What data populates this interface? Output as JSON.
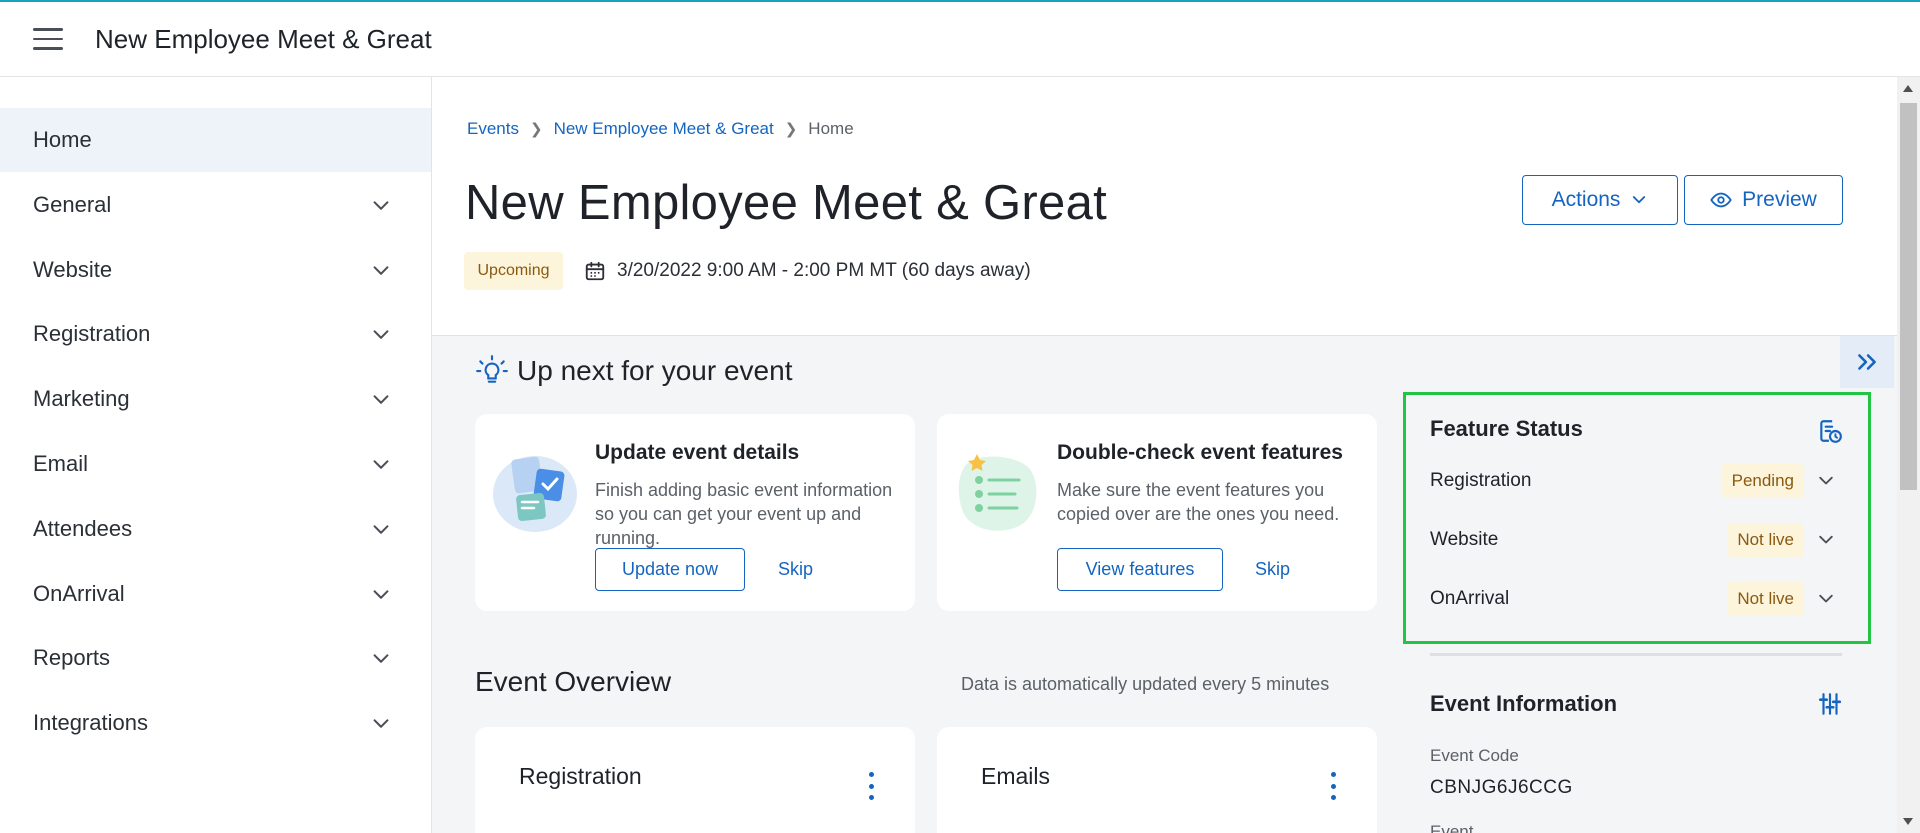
{
  "app": {
    "title": "New Employee Meet & Great"
  },
  "sidebar": {
    "items": [
      {
        "label": "Home",
        "active": true
      },
      {
        "label": "General"
      },
      {
        "label": "Website"
      },
      {
        "label": "Registration"
      },
      {
        "label": "Marketing"
      },
      {
        "label": "Email"
      },
      {
        "label": "Attendees"
      },
      {
        "label": "OnArrival"
      },
      {
        "label": "Reports"
      },
      {
        "label": "Integrations"
      }
    ]
  },
  "breadcrumb": {
    "items": [
      "Events",
      "New Employee Meet & Great"
    ],
    "current": "Home"
  },
  "header": {
    "title": "New Employee Meet & Great",
    "status": "Upcoming",
    "date_range": "3/20/2022 9:00 AM - 2:00 PM MT (60 days away)",
    "actions_label": "Actions",
    "preview_label": "Preview"
  },
  "up_next": {
    "title": "Up next for your event",
    "cards": [
      {
        "title": "Update event details",
        "description": "Finish adding basic event information so you can get your event up and running.",
        "primary_label": "Update now",
        "skip_label": "Skip"
      },
      {
        "title": "Double-check event features",
        "description": "Make sure the event features you copied over are the ones you need.",
        "primary_label": "View features",
        "skip_label": "Skip"
      }
    ]
  },
  "overview": {
    "title": "Event Overview",
    "note": "Data is automatically updated every 5 minutes",
    "cards": [
      "Registration",
      "Emails"
    ]
  },
  "feature_status": {
    "title": "Feature Status",
    "rows": [
      {
        "label": "Registration",
        "status": "Pending"
      },
      {
        "label": "Website",
        "status": "Not live"
      },
      {
        "label": "OnArrival",
        "status": "Not live"
      }
    ]
  },
  "event_info": {
    "title": "Event Information",
    "code_label": "Event Code",
    "code_value": "CBNJG6J6CCG",
    "next_label": "Event Format"
  },
  "colors": {
    "accent": "#1565c0",
    "highlight": "#22c443",
    "badge_bg": "#fdf4dc",
    "badge_text": "#8a5a0f"
  }
}
